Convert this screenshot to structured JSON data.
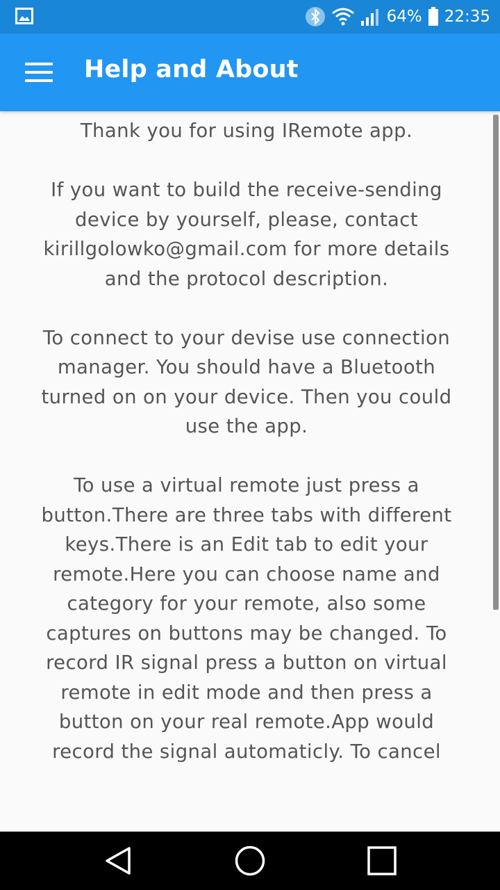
{
  "status_bar": {
    "battery_percent": "64%",
    "time": "22:35",
    "icons": [
      "gallery-notification-icon",
      "bluetooth-icon",
      "wifi-icon",
      "signal-icon",
      "battery-icon"
    ]
  },
  "app_bar": {
    "title": "Help and About",
    "menu_icon": "hamburger-menu-icon",
    "color": "#2196f3"
  },
  "content": {
    "paragraphs": [
      "Thank you for using IRemote app.",
      "If you want to build the receive-sending device by yourself, please, contact kirillgolowko@gmail.com for more details and the protocol description.",
      "To connect to your devise use connection manager. You should have a Bluetooth turned on on your device. Then you could use the app.",
      "To use a virtual remote just press a button.There are three tabs with different keys.There is an Edit tab to edit your remote.Here you can choose name and category for your remote, also some captures on buttons may be changed. To record IR signal press a button on virtual remote in edit mode and then press a button on your real remote.App would record the signal automaticly. To cancel"
    ]
  },
  "nav_bar": {
    "buttons": [
      "back-icon",
      "home-icon",
      "recents-icon"
    ]
  }
}
